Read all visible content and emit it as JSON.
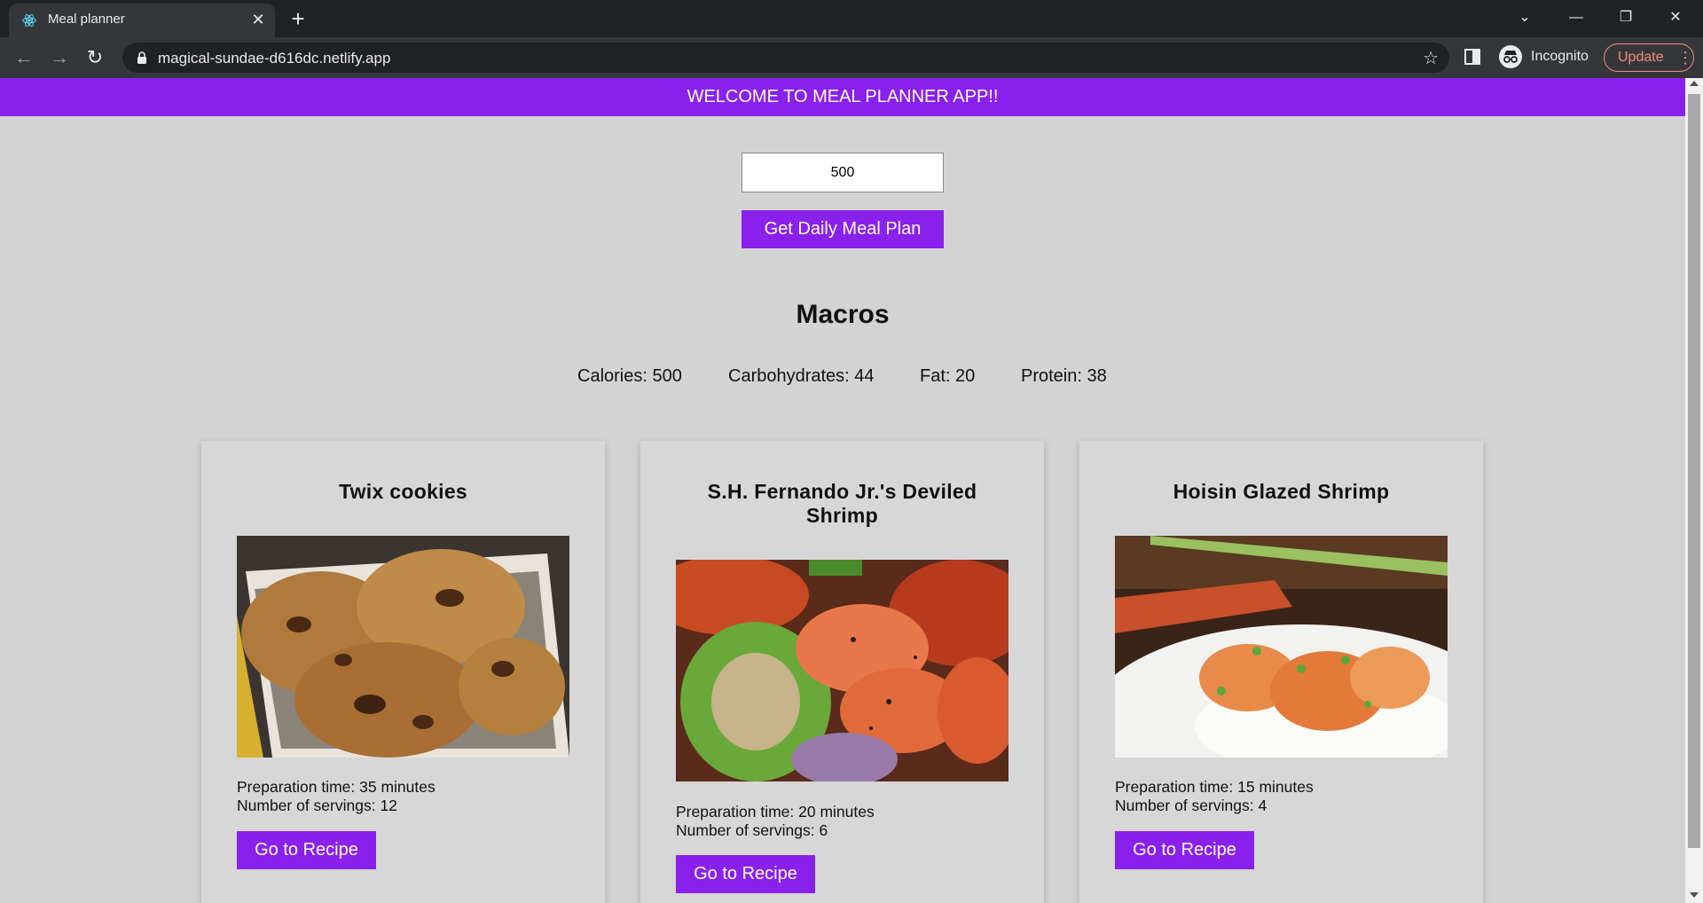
{
  "browser": {
    "tab_title": "Meal planner",
    "url": "magical-sundae-d616dc.netlify.app",
    "profile_label": "Incognito",
    "update_label": "Update"
  },
  "banner": {
    "text": "WELCOME TO MEAL PLANNER APP!!"
  },
  "calorie_input": {
    "value": "500"
  },
  "plan_button": {
    "label": "Get Daily Meal Plan"
  },
  "macros": {
    "title": "Macros",
    "calories": "Calories: 500",
    "carbohydrates": "Carbohydrates: 44",
    "fat": "Fat: 20",
    "protein": "Protein: 38"
  },
  "meals": [
    {
      "title": "Twix cookies",
      "image": "cookies-photo",
      "prep_time": "Preparation time: 35 minutes",
      "servings": "Number of servings: 12",
      "button": "Go to Recipe"
    },
    {
      "title": "S.H. Fernando Jr.'s Deviled Shrimp",
      "image": "deviled-shrimp-photo",
      "prep_time": "Preparation time: 20 minutes",
      "servings": "Number of servings: 6",
      "button": "Go to Recipe"
    },
    {
      "title": "Hoisin Glazed Shrimp",
      "image": "glazed-shrimp-photo",
      "prep_time": "Preparation time: 15 minutes",
      "servings": "Number of servings: 4",
      "button": "Go to Recipe"
    }
  ],
  "colors": {
    "accent": "#8a20ec",
    "page_background": "#d3d3d3",
    "card_background": "#d7d7d7"
  }
}
